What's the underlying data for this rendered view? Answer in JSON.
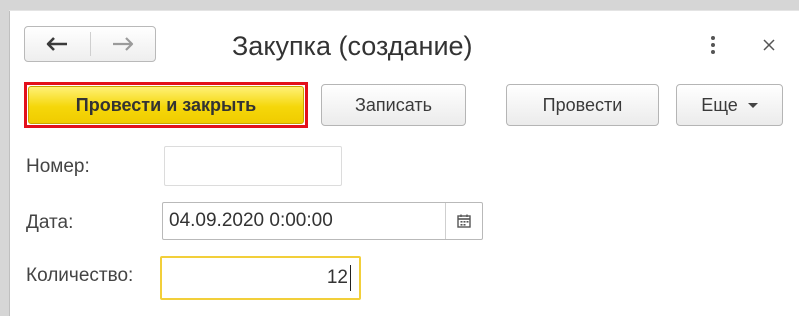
{
  "window": {
    "title": "Закупка (создание)",
    "close_label": "×"
  },
  "navigation": {
    "back_icon": "arrow-left-icon",
    "forward_icon": "arrow-right-icon"
  },
  "toolbar": {
    "post_and_close_label": "Провести и закрыть",
    "write_label": "Записать",
    "post_label": "Провести",
    "more_label": "Еще"
  },
  "form": {
    "number": {
      "label": "Номер:",
      "value": ""
    },
    "date": {
      "label": "Дата:",
      "value": "04.09.2020  0:00:00"
    },
    "quantity": {
      "label": "Количество:",
      "value": "12"
    }
  },
  "colors": {
    "primary_button": "#f5d70a",
    "highlight_frame": "#e3101b",
    "active_field_border": "#f2cf3a"
  }
}
